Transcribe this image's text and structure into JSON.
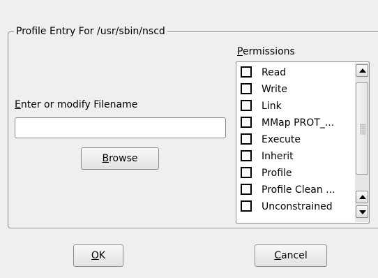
{
  "group": {
    "title": "Profile Entry For /usr/sbin/nscd"
  },
  "filename": {
    "label_mnemonic": "E",
    "label_rest": "nter or modify Filename",
    "value": ""
  },
  "browse": {
    "mnemonic": "B",
    "rest": "rowse"
  },
  "permissions": {
    "label_mnemonic": "P",
    "label_rest": "ermissions",
    "items": [
      {
        "label": "Read",
        "checked": false
      },
      {
        "label": "Write",
        "checked": false
      },
      {
        "label": "Link",
        "checked": false
      },
      {
        "label": "MMap PROT_...",
        "checked": false
      },
      {
        "label": "Execute",
        "checked": false
      },
      {
        "label": "Inherit",
        "checked": false
      },
      {
        "label": "Profile",
        "checked": false
      },
      {
        "label": "Profile Clean ...",
        "checked": false
      },
      {
        "label": "Unconstrained",
        "checked": false
      }
    ]
  },
  "buttons": {
    "ok": {
      "mnemonic": "O",
      "rest": "K"
    },
    "cancel": {
      "mnemonic": "C",
      "rest": "ancel"
    }
  }
}
